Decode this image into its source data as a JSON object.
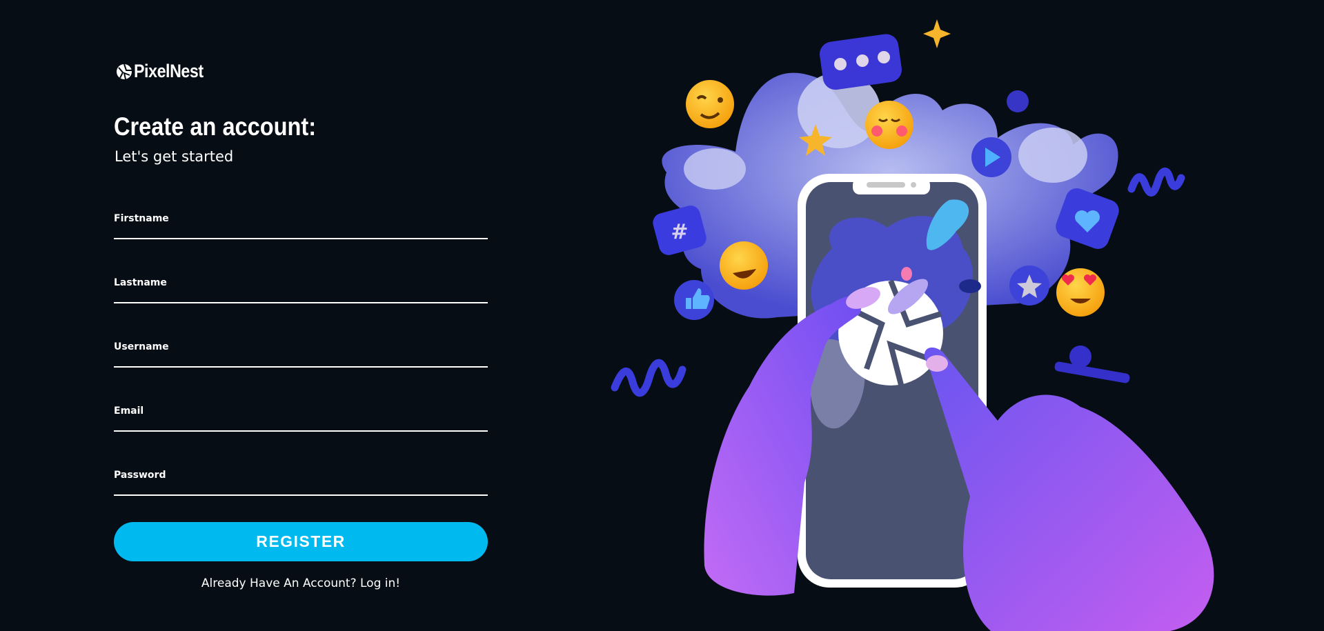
{
  "brand": {
    "name": "PixelNest"
  },
  "form": {
    "title": "Create an account:",
    "subtitle": "Let's get started",
    "fields": [
      {
        "label": "Firstname",
        "value": ""
      },
      {
        "label": "Lastname",
        "value": ""
      },
      {
        "label": "Username",
        "value": ""
      },
      {
        "label": "Email",
        "value": ""
      },
      {
        "label": "Password",
        "value": ""
      }
    ],
    "register_label": "REGISTER",
    "login_prompt": "Already Have An Account? Log in!"
  },
  "illustration": {
    "subject": "hands-holding-phone-with-emojis",
    "icons": [
      "camera-shutter-icon",
      "emoji-icons",
      "hashtag-icon",
      "heart-icon",
      "play-icon",
      "like-icon",
      "star-icon",
      "chat-bubble-icon",
      "sparkle-icon"
    ]
  },
  "colors": {
    "background": "#060d14",
    "accent": "#00b9ee",
    "text": "#ffffff"
  }
}
